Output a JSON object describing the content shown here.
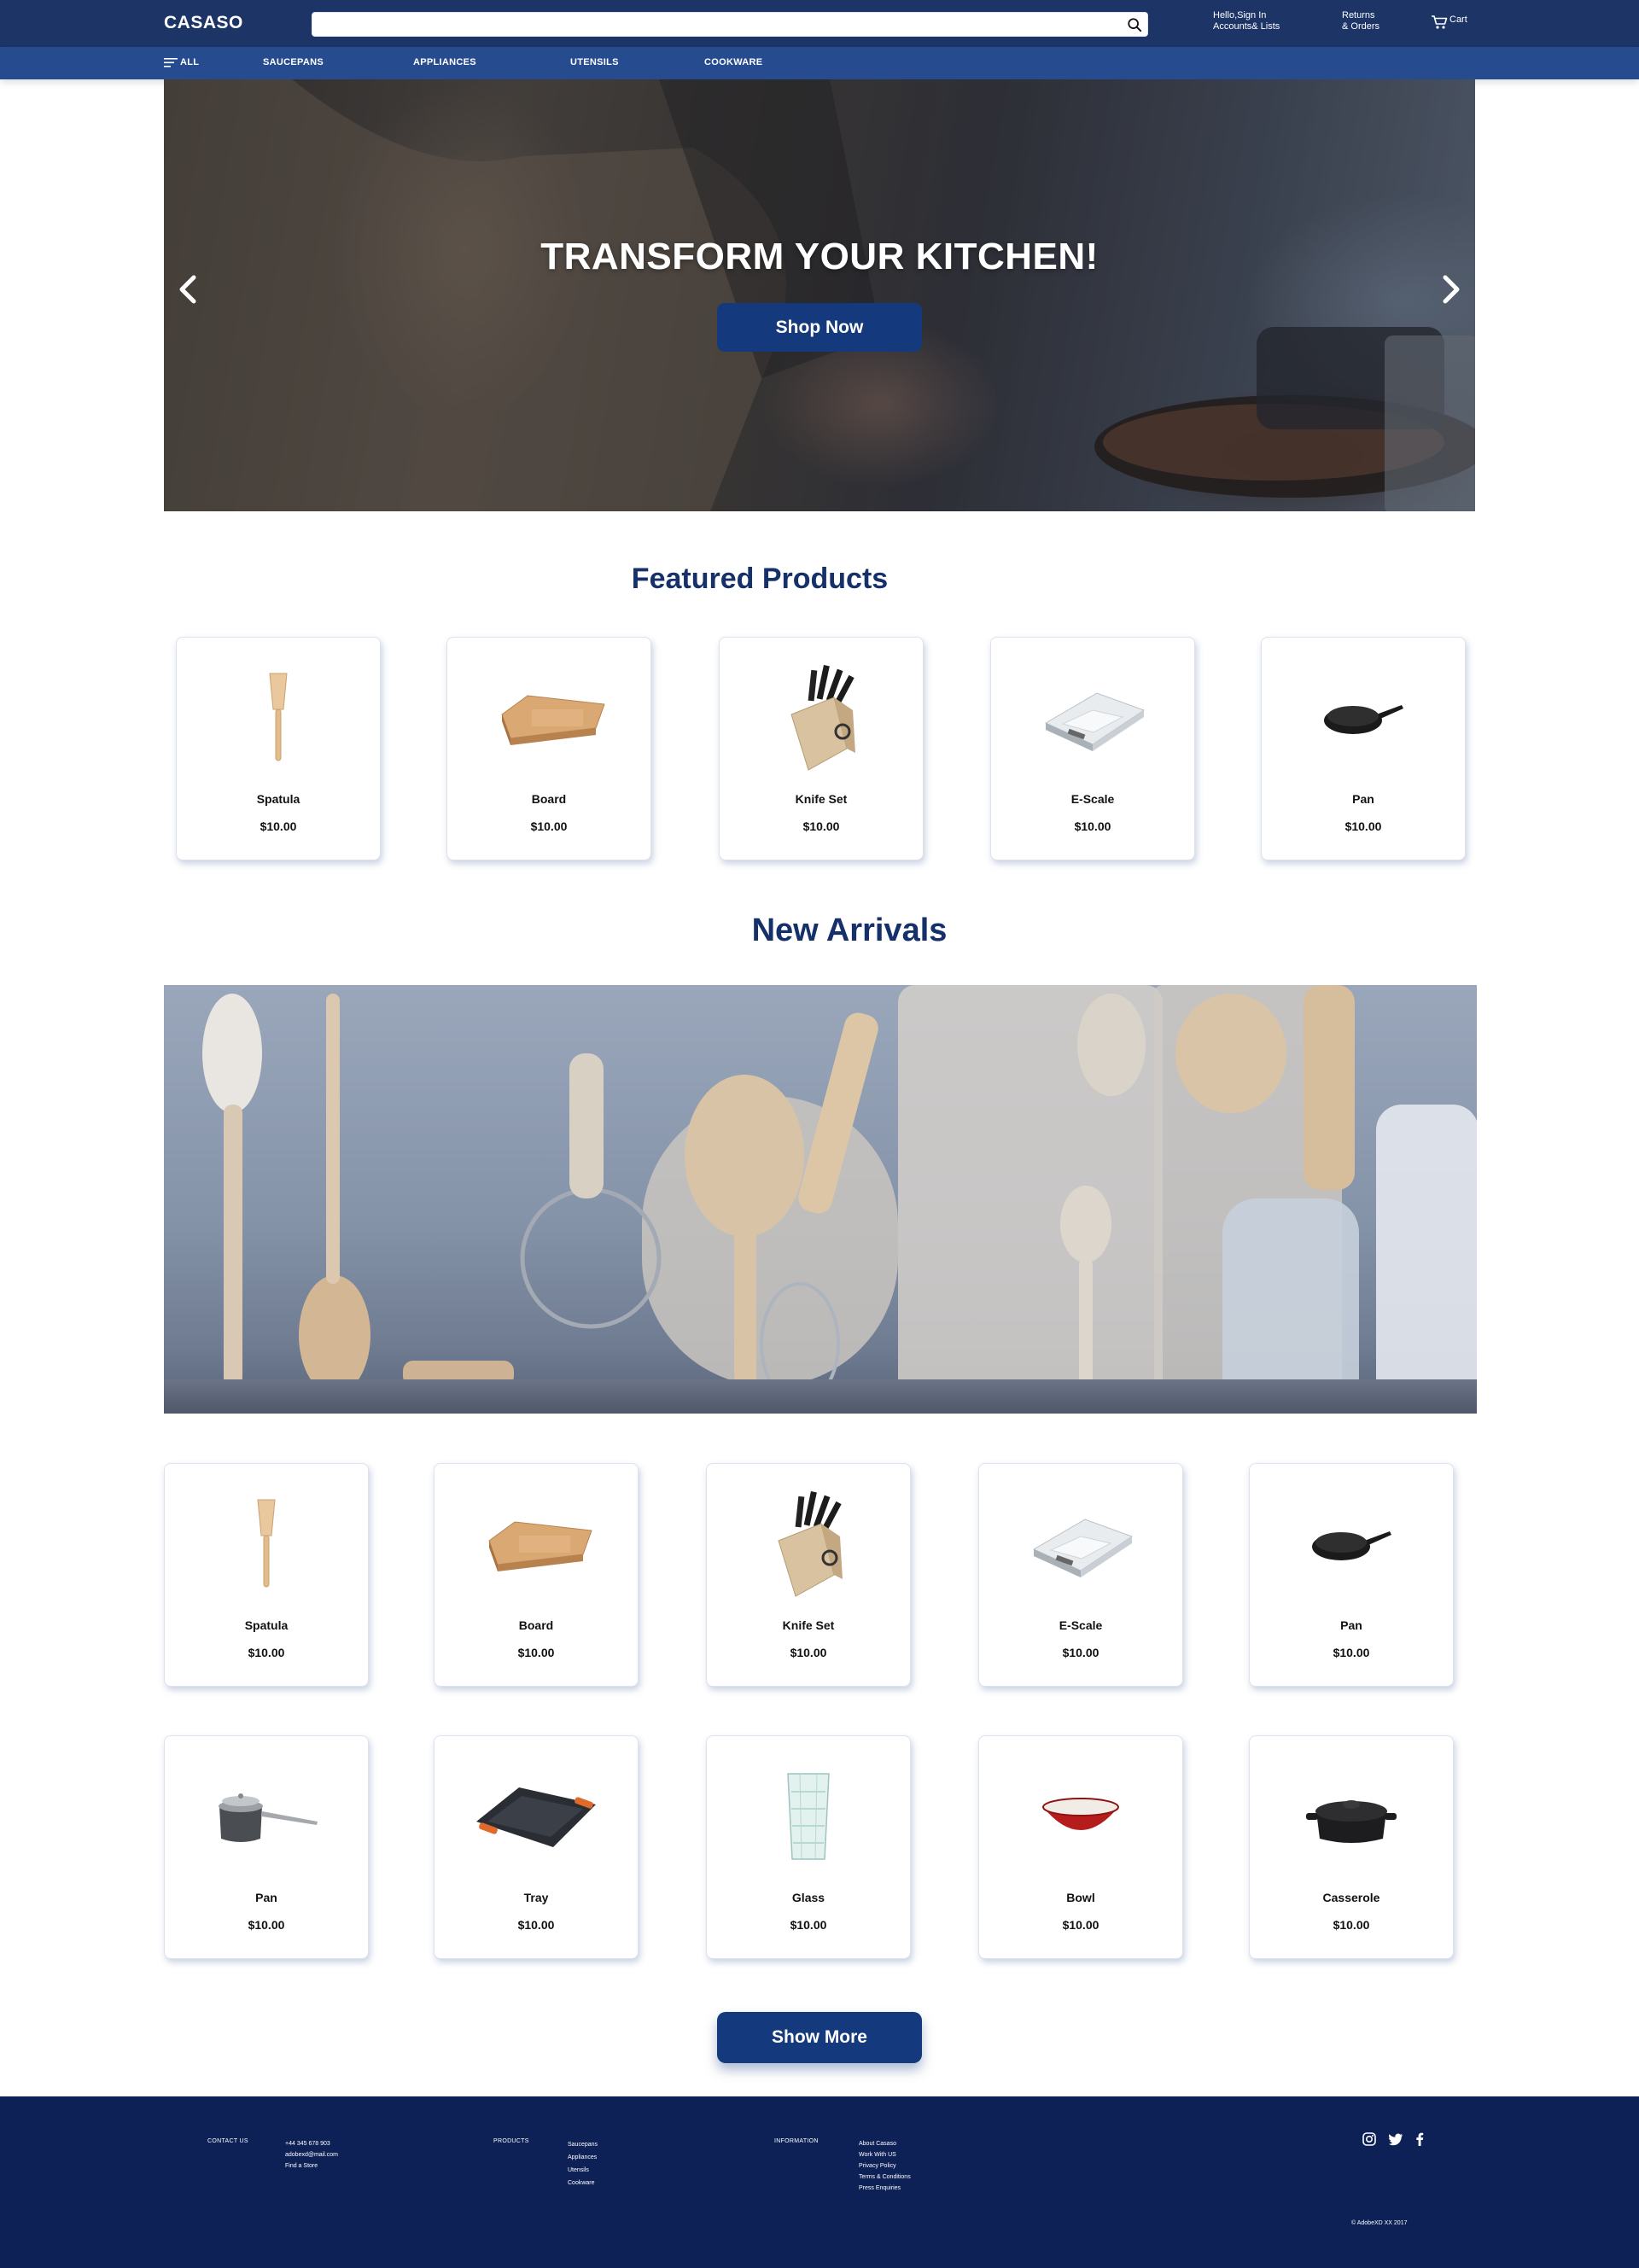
{
  "header": {
    "logo": "CASASO",
    "search": {
      "value": "",
      "placeholder": ""
    },
    "account_line1": "Hello,Sign In",
    "account_line2": "Accounts& Lists",
    "returns_line1": "Returns",
    "returns_line2": "& Orders",
    "cart_label": "Cart"
  },
  "nav": {
    "all_label": "ALL",
    "items": [
      "SAUCEPANS",
      "APPLIANCES",
      "UTENSILS",
      "COOKWARE"
    ]
  },
  "hero": {
    "title": "TRANSFORM YOUR KITCHEN!",
    "button_label": "Shop Now"
  },
  "featured": {
    "title": "Featured Products",
    "products": [
      {
        "name": "Spatula",
        "price": "$10.00",
        "icon": "spatula-icon"
      },
      {
        "name": "Board",
        "price": "$10.00",
        "icon": "board-icon"
      },
      {
        "name": "Knife Set",
        "price": "$10.00",
        "icon": "knife-set-icon"
      },
      {
        "name": "E-Scale",
        "price": "$10.00",
        "icon": "scale-icon"
      },
      {
        "name": "Pan",
        "price": "$10.00",
        "icon": "skillet-icon"
      }
    ]
  },
  "new_arrivals": {
    "title": "New Arrivals",
    "row1": [
      {
        "name": "Spatula",
        "price": "$10.00",
        "icon": "spatula-icon"
      },
      {
        "name": "Board",
        "price": "$10.00",
        "icon": "board-icon"
      },
      {
        "name": "Knife Set",
        "price": "$10.00",
        "icon": "knife-set-icon"
      },
      {
        "name": "E-Scale",
        "price": "$10.00",
        "icon": "scale-icon"
      },
      {
        "name": "Pan",
        "price": "$10.00",
        "icon": "skillet-icon"
      }
    ],
    "row2": [
      {
        "name": "Pan",
        "price": "$10.00",
        "icon": "saucepan-icon"
      },
      {
        "name": "Tray",
        "price": "$10.00",
        "icon": "tray-icon"
      },
      {
        "name": "Glass",
        "price": "$10.00",
        "icon": "glass-icon"
      },
      {
        "name": "Bowl",
        "price": "$10.00",
        "icon": "bowl-icon"
      },
      {
        "name": "Casserole",
        "price": "$10.00",
        "icon": "casserole-icon"
      }
    ],
    "show_more_label": "Show More"
  },
  "footer": {
    "contact": {
      "heading": "CONTACT US",
      "lines": [
        "+44 345 678 903",
        "adobexd@mail.com",
        "Find a Store"
      ]
    },
    "products": {
      "heading": "PRODUCTS",
      "lines": [
        "Saucepans",
        "Appliances",
        "Utensils",
        "Cookware"
      ]
    },
    "information": {
      "heading": "INFORMATION",
      "lines": [
        "About Casaso",
        "Work With US",
        "Privacy Policy",
        "Terms & Conditions",
        "Press Enquiries"
      ]
    },
    "social": [
      "instagram-icon",
      "twitter-icon",
      "facebook-icon"
    ],
    "copyright": "© AdobeXD XX 2017"
  },
  "colors": {
    "topbar": "#1c3466",
    "navbar": "#264b8f",
    "accent": "#143a7d",
    "title": "#16306a",
    "footer": "#0d2157"
  }
}
